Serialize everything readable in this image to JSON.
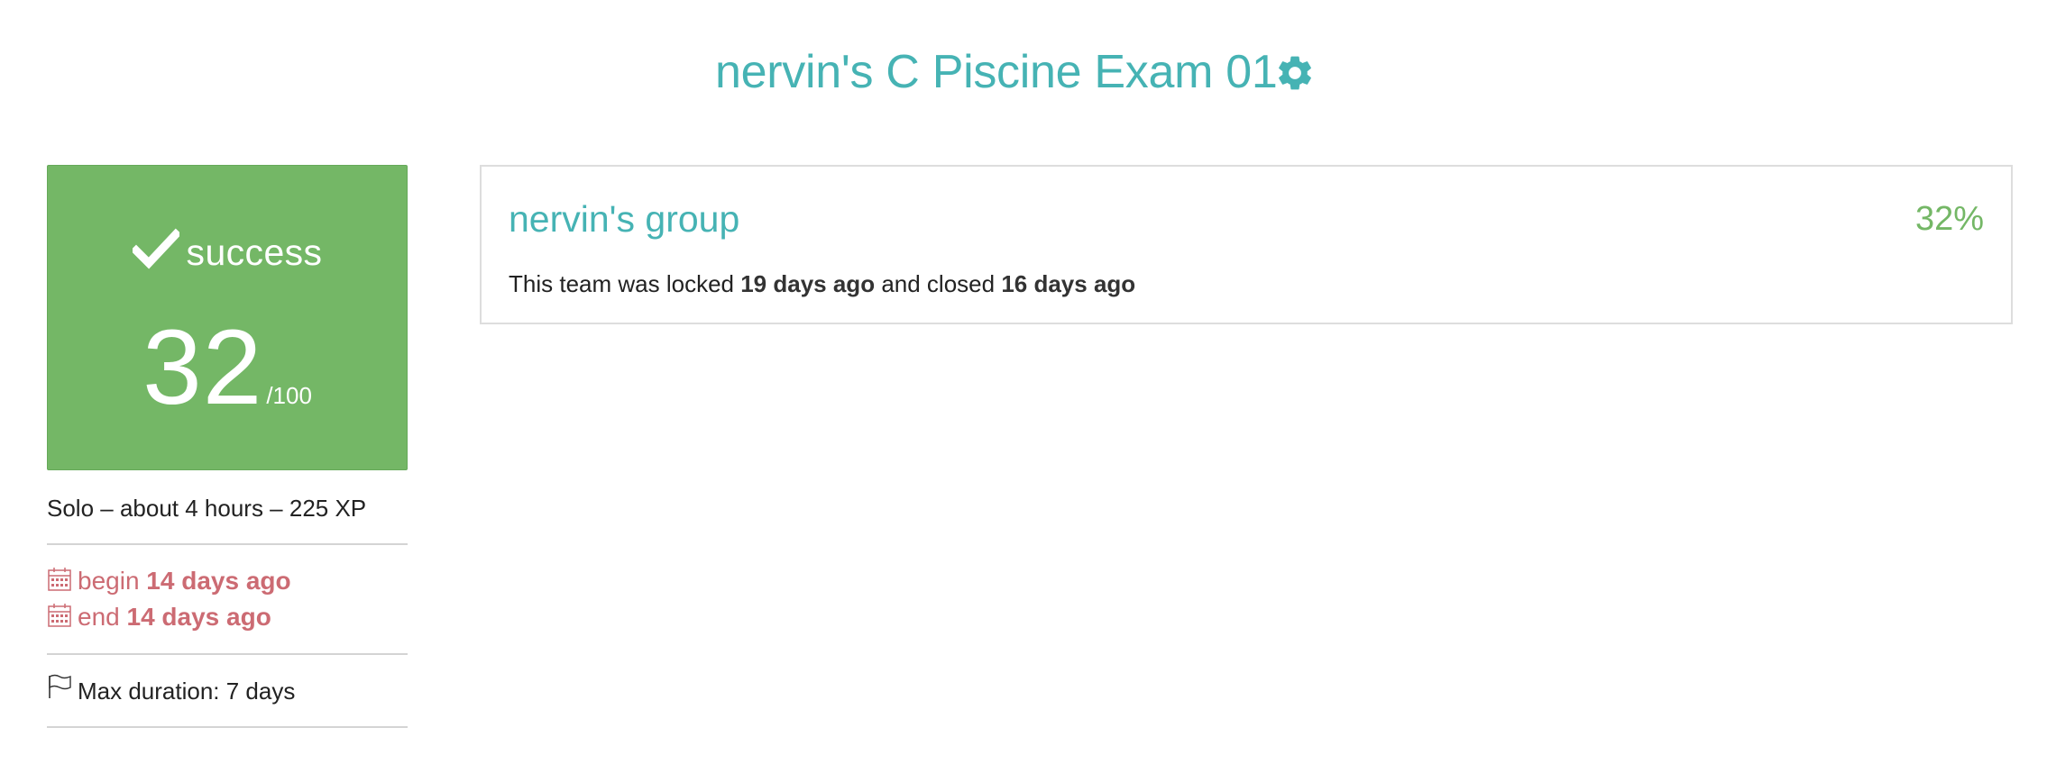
{
  "header": {
    "title": "nervin's C Piscine Exam 01",
    "settings_icon": "gear-icon"
  },
  "score_card": {
    "status_icon": "check-icon",
    "status": "success",
    "score": "32",
    "max": "/100",
    "color": "#74b766"
  },
  "project_info": {
    "summary": "Solo – about 4 hours – 225 XP",
    "begin_label": "begin",
    "begin_value": "14 days ago",
    "end_label": "end",
    "end_value": "14 days ago",
    "calendar_icon": "calendar-icon",
    "duration_icon": "flag-icon",
    "duration": "Max duration: 7 days"
  },
  "team": {
    "name": "nervin's group",
    "percent": "32%",
    "desc_prefix": "This team was locked",
    "locked": "19 days ago",
    "desc_middle": "and closed",
    "closed": "16 days ago"
  },
  "colors": {
    "accent": "#46b3b4",
    "success": "#74b766",
    "date": "#cc6b73"
  }
}
